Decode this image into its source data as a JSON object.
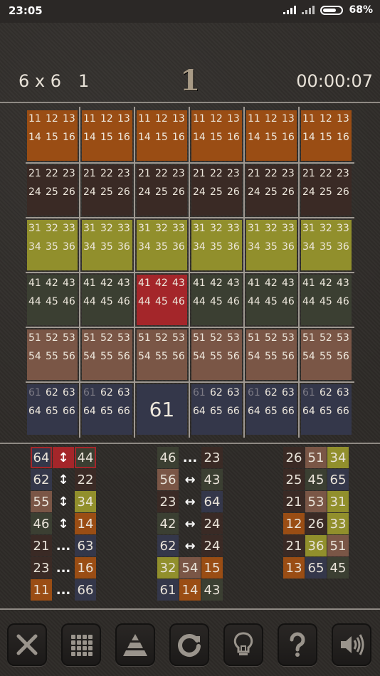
{
  "status_bar": {
    "time": "23:05",
    "battery": "68%"
  },
  "header": {
    "size": "6 x 6",
    "level": "1",
    "moves": "1",
    "timer": "00:00:07"
  },
  "colors": {
    "orange": "#9a4d14",
    "maroon": "#3a2a25",
    "olive": "#918f2c",
    "darkgreen": "#3b3f32",
    "brown": "#7a5646",
    "navy": "#34374a",
    "red": "#a4262a",
    "cell_bg": "#2f2d2b"
  },
  "board": {
    "rows": [
      {
        "color": "orange",
        "tiles": [
          [
            "11",
            "12",
            "13",
            "14",
            "15",
            "16"
          ],
          [
            "11",
            "12",
            "13",
            "14",
            "15",
            "16"
          ],
          [
            "11",
            "12",
            "13",
            "14",
            "15",
            "16"
          ],
          [
            "11",
            "12",
            "13",
            "14",
            "15",
            "16"
          ],
          [
            "11",
            "12",
            "13",
            "14",
            "15",
            "16"
          ],
          [
            "11",
            "12",
            "13",
            "14",
            "15",
            "16"
          ]
        ]
      },
      {
        "color": "maroon",
        "tiles": [
          [
            "21",
            "22",
            "23",
            "24",
            "25",
            "26"
          ],
          [
            "21",
            "22",
            "23",
            "24",
            "25",
            "26"
          ],
          [
            "21",
            "22",
            "23",
            "24",
            "25",
            "26"
          ],
          [
            "21",
            "22",
            "23",
            "24",
            "25",
            "26"
          ],
          [
            "21",
            "22",
            "23",
            "24",
            "25",
            "26"
          ],
          [
            "21",
            "22",
            "23",
            "24",
            "25",
            "26"
          ]
        ]
      },
      {
        "color": "olive",
        "tiles": [
          [
            "31",
            "32",
            "33",
            "34",
            "35",
            "36"
          ],
          [
            "31",
            "32",
            "33",
            "34",
            "35",
            "36"
          ],
          [
            "31",
            "32",
            "33",
            "34",
            "35",
            "36"
          ],
          [
            "31",
            "32",
            "33",
            "34",
            "35",
            "36"
          ],
          [
            "31",
            "32",
            "33",
            "34",
            "35",
            "36"
          ],
          [
            "31",
            "32",
            "33",
            "34",
            "35",
            "36"
          ]
        ]
      },
      {
        "color": "darkgreen",
        "tiles": [
          [
            "41",
            "42",
            "43",
            "44",
            "45",
            "46"
          ],
          [
            "41",
            "42",
            "43",
            "44",
            "45",
            "46"
          ],
          [
            "41",
            "42",
            "43",
            "44",
            "45",
            "46"
          ],
          [
            "41",
            "42",
            "43",
            "44",
            "45",
            "46"
          ],
          [
            "41",
            "42",
            "43",
            "44",
            "45",
            "46"
          ],
          [
            "41",
            "42",
            "43",
            "44",
            "45",
            "46"
          ]
        ]
      },
      {
        "color": "brown",
        "tiles": [
          [
            "51",
            "52",
            "53",
            "54",
            "55",
            "56"
          ],
          [
            "51",
            "52",
            "53",
            "54",
            "55",
            "56"
          ],
          [
            "51",
            "52",
            "53",
            "54",
            "55",
            "56"
          ],
          [
            "51",
            "52",
            "53",
            "54",
            "55",
            "56"
          ],
          [
            "51",
            "52",
            "53",
            "54",
            "55",
            "56"
          ],
          [
            "51",
            "52",
            "53",
            "54",
            "55",
            "56"
          ]
        ]
      },
      {
        "color": "navy",
        "tiles": [
          [
            "61",
            "62",
            "63",
            "64",
            "65",
            "66"
          ],
          [
            "61",
            "62",
            "63",
            "64",
            "65",
            "66"
          ],
          "61",
          [
            "61",
            "62",
            "63",
            "64",
            "65",
            "66"
          ],
          [
            "61",
            "62",
            "63",
            "64",
            "65",
            "66"
          ],
          [
            "61",
            "62",
            "63",
            "64",
            "65",
            "66"
          ]
        ]
      }
    ],
    "highlight": {
      "row": 3,
      "col": 2,
      "color": "red"
    }
  },
  "moves_list": {
    "col1": [
      [
        {
          "t": "64",
          "c": "navy",
          "hl": true
        },
        {
          "op": "↕",
          "c": "red"
        },
        {
          "t": "44",
          "c": "darkgreen",
          "hl": true
        }
      ],
      [
        {
          "t": "62",
          "c": "navy"
        },
        {
          "op": "↕"
        },
        {
          "t": "22",
          "c": "maroon"
        }
      ],
      [
        {
          "t": "55",
          "c": "brown"
        },
        {
          "op": "↕"
        },
        {
          "t": "34",
          "c": "olive"
        }
      ],
      [
        {
          "t": "46",
          "c": "darkgreen"
        },
        {
          "op": "↕"
        },
        {
          "t": "14",
          "c": "orange"
        }
      ],
      [
        {
          "t": "21",
          "c": "maroon"
        },
        {
          "op": "..."
        },
        {
          "t": "63",
          "c": "navy"
        }
      ],
      [
        {
          "t": "23",
          "c": "maroon"
        },
        {
          "op": "..."
        },
        {
          "t": "16",
          "c": "orange"
        }
      ],
      [
        {
          "t": "11",
          "c": "orange"
        },
        {
          "op": "..."
        },
        {
          "t": "66",
          "c": "navy"
        }
      ]
    ],
    "col2": [
      [
        {
          "t": "46",
          "c": "darkgreen"
        },
        {
          "op": "..."
        },
        {
          "t": "23",
          "c": "maroon"
        }
      ],
      [
        {
          "t": "56",
          "c": "brown"
        },
        {
          "op": "↔"
        },
        {
          "t": "43",
          "c": "darkgreen"
        }
      ],
      [
        {
          "t": "23",
          "c": "maroon"
        },
        {
          "op": "↔"
        },
        {
          "t": "64",
          "c": "navy"
        }
      ],
      [
        {
          "t": "42",
          "c": "darkgreen"
        },
        {
          "op": "↔"
        },
        {
          "t": "24",
          "c": "maroon"
        }
      ],
      [
        {
          "t": "62",
          "c": "navy"
        },
        {
          "op": "↔"
        },
        {
          "t": "24",
          "c": "maroon"
        }
      ],
      [
        {
          "t": "32",
          "c": "olive"
        },
        {
          "t": "54",
          "c": "brown"
        },
        {
          "t": "15",
          "c": "orange"
        }
      ],
      [
        {
          "t": "61",
          "c": "navy"
        },
        {
          "t": "14",
          "c": "orange"
        },
        {
          "t": "43",
          "c": "darkgreen"
        }
      ]
    ],
    "col3": [
      [
        {
          "t": "26",
          "c": "maroon"
        },
        {
          "t": "51",
          "c": "brown"
        },
        {
          "t": "34",
          "c": "olive"
        }
      ],
      [
        {
          "t": "25",
          "c": "maroon"
        },
        {
          "t": "45",
          "c": "darkgreen"
        },
        {
          "t": "65",
          "c": "navy"
        }
      ],
      [
        {
          "t": "21",
          "c": "maroon"
        },
        {
          "t": "53",
          "c": "brown"
        },
        {
          "t": "31",
          "c": "olive"
        }
      ],
      [
        {
          "t": "12",
          "c": "orange"
        },
        {
          "t": "26",
          "c": "maroon"
        },
        {
          "t": "33",
          "c": "olive"
        }
      ],
      [
        {
          "t": "21",
          "c": "maroon"
        },
        {
          "t": "36",
          "c": "olive"
        },
        {
          "t": "51",
          "c": "brown"
        }
      ],
      [
        {
          "t": "13",
          "c": "orange"
        },
        {
          "t": "65",
          "c": "navy"
        },
        {
          "t": "45",
          "c": "darkgreen"
        }
      ]
    ]
  },
  "toolbar": [
    {
      "name": "close-button",
      "icon": "close-icon"
    },
    {
      "name": "grid-button",
      "icon": "grid-icon"
    },
    {
      "name": "pyramid-button",
      "icon": "pyramid-icon"
    },
    {
      "name": "restart-button",
      "icon": "restart-icon"
    },
    {
      "name": "hint-button",
      "icon": "lightbulb-icon"
    },
    {
      "name": "help-button",
      "icon": "question-icon"
    },
    {
      "name": "sound-button",
      "icon": "speaker-icon"
    }
  ]
}
